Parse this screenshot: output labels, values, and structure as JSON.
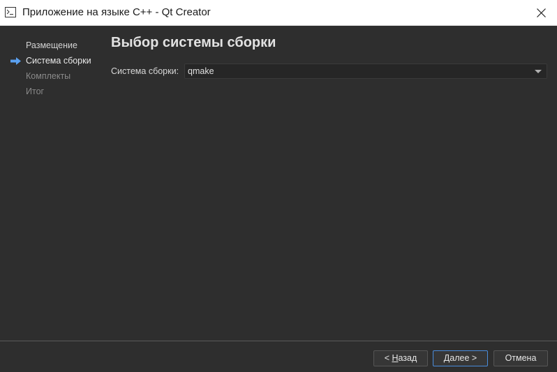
{
  "window": {
    "title": "Приложение на языке C++ - Qt Creator",
    "icon": "terminal-icon"
  },
  "steps": [
    {
      "label": "Размещение",
      "state": "done"
    },
    {
      "label": "Система сборки",
      "state": "current"
    },
    {
      "label": "Комплекты",
      "state": "pending"
    },
    {
      "label": "Итог",
      "state": "pending"
    }
  ],
  "page": {
    "title": "Выбор системы сборки",
    "build_system_label": "Система сборки:",
    "build_system_value": "qmake"
  },
  "buttons": {
    "back_prefix": "< ",
    "back_mnemonic": "Н",
    "back_rest": "азад",
    "next_mnemonic": "Д",
    "next_rest": "алее >",
    "cancel": "Отмена"
  },
  "colors": {
    "background": "#2e2e2e",
    "accent": "#4a8cdb",
    "current_step_arrow": "#5aa0f0"
  }
}
